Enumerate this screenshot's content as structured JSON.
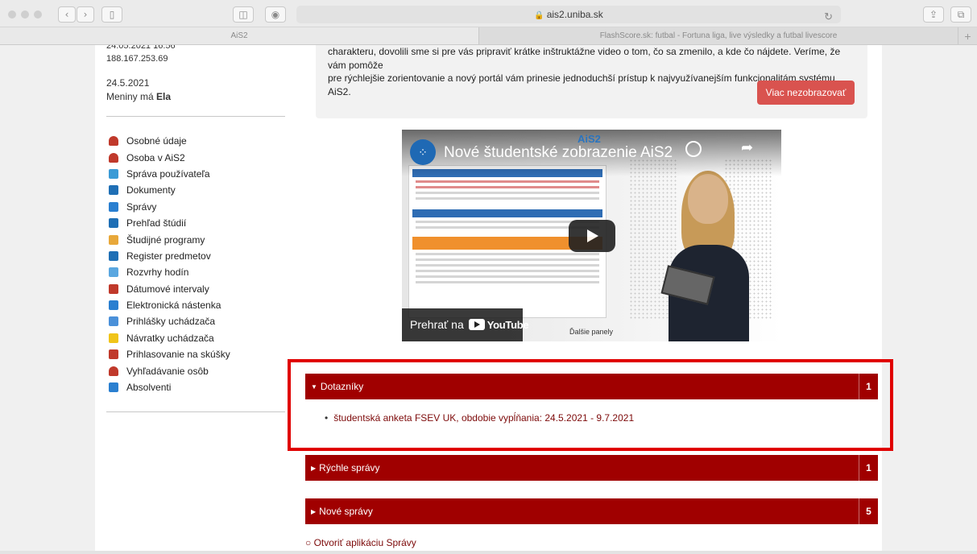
{
  "browser": {
    "url": "ais2.uniba.sk",
    "tabs": [
      {
        "label": "AiS2",
        "active": true
      },
      {
        "label": "FlashScore.sk: futbal - Fortuna liga, live výsledky a futbal livescore",
        "active": false
      }
    ],
    "new_tab": "+"
  },
  "sidebar": {
    "meta_line1": "24.05.2021 16:56",
    "meta_line2": "188.167.253.69",
    "date": "24.5.2021",
    "nameday_prefix": "Meniny má ",
    "nameday_name": "Ela",
    "items": [
      {
        "label": "Osobné údaje",
        "icon": "person-icon",
        "color": "#c0392b"
      },
      {
        "label": "Osoba v AiS2",
        "icon": "person-icon",
        "color": "#c0392b"
      },
      {
        "label": "Správa používateľa",
        "icon": "org-chart-icon",
        "color": "#3b9bd6"
      },
      {
        "label": "Dokumenty",
        "icon": "document-icon",
        "color": "#1f6fb5"
      },
      {
        "label": "Správy",
        "icon": "message-icon",
        "color": "#2a7fd0"
      },
      {
        "label": "Prehľad štúdií",
        "icon": "overview-icon",
        "color": "#1f6fb5"
      },
      {
        "label": "Študijné programy",
        "icon": "program-icon",
        "color": "#e8a83a"
      },
      {
        "label": "Register predmetov",
        "icon": "register-icon",
        "color": "#1f6fb5"
      },
      {
        "label": "Rozvrhy hodín",
        "icon": "schedule-icon",
        "color": "#5aa7e0"
      },
      {
        "label": "Dátumové intervaly",
        "icon": "calendar-icon",
        "color": "#c0392b"
      },
      {
        "label": "Elektronická nástenka",
        "icon": "board-icon",
        "color": "#2a7fd0"
      },
      {
        "label": "Prihlášky uchádzača",
        "icon": "application-icon",
        "color": "#4a90d9"
      },
      {
        "label": "Návratky uchádzača",
        "icon": "return-icon",
        "color": "#f0c419"
      },
      {
        "label": "Prihlasovanie na skúšky",
        "icon": "exam-icon",
        "color": "#c0392b"
      },
      {
        "label": "Vyhľadávanie osôb",
        "icon": "search-person-icon",
        "color": "#c0392b"
      },
      {
        "label": "Absolventi",
        "icon": "graduate-icon",
        "color": "#2a7fd0"
      }
    ]
  },
  "notice": {
    "line1": "charakteru, dovolili sme si pre vás pripraviť krátke inštruktážne video o tom, čo sa zmenilo, a kde čo nájdete. Veríme, že vám pomôže",
    "line2": "pre rýchlejšie zorientovanie a nový portál vám prinesie jednoduchší prístup k najvyužívanejším funkcionalitám systému AiS2.",
    "button": "Viac nezobrazovať"
  },
  "video": {
    "title": "Nové študentské zobrazenie AiS2",
    "brand": "AiS2",
    "youtube_prefix": "Prehrať na",
    "youtube_word": "YouTube",
    "caption": "Ďalšie panely"
  },
  "panels": {
    "dotazniky": {
      "title": "Dotazníky",
      "count": "1",
      "item": "študentská anketa FSEV UK, obdobie vypĺňania: 24.5.2021 - 9.7.2021"
    },
    "rychle": {
      "title": "Rýchle správy",
      "count": "1"
    },
    "nove": {
      "title": "Nové správy",
      "count": "5"
    }
  },
  "footer_link": "○ Otvoriť aplikáciu Správy"
}
